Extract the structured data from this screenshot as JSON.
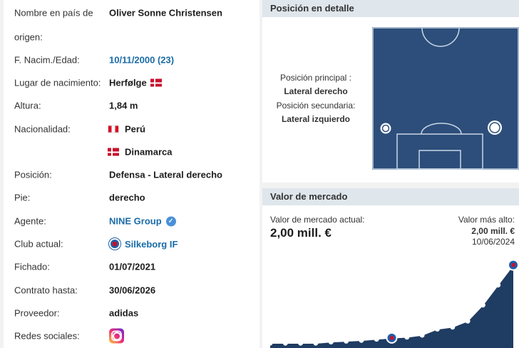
{
  "info_rows": [
    {
      "label": "Nombre en país de",
      "value": "Oliver Sonne Christensen"
    },
    {
      "label": "origen:",
      "value": ""
    },
    {
      "label": "F. Nacim./Edad:",
      "value": "10/11/2000 (23)"
    },
    {
      "label": "Lugar de nacimiento:",
      "value": "Herfølge"
    },
    {
      "label": "Altura:",
      "value": "1,84 m"
    },
    {
      "label": "Nacionalidad:",
      "value": "Perú"
    },
    {
      "label": "",
      "value": "Dinamarca"
    },
    {
      "label": "Posición:",
      "value": "Defensa - Lateral derecho"
    },
    {
      "label": "Pie:",
      "value": "derecho"
    },
    {
      "label": "Agente:",
      "value": "NINE Group"
    },
    {
      "label": "Club actual:",
      "value": "Silkeborg IF"
    },
    {
      "label": "Fichado:",
      "value": "01/07/2021"
    },
    {
      "label": "Contrato hasta:",
      "value": "30/06/2026"
    },
    {
      "label": "Proveedor:",
      "value": "adidas"
    },
    {
      "label": "Redes sociales:",
      "value": ""
    }
  ],
  "position_panel": {
    "title": "Posición en detalle",
    "main_label": "Posición principal :",
    "main_value": "Lateral derecho",
    "secondary_label": "Posición secundaria:",
    "secondary_value": "Lateral izquierdo"
  },
  "market_panel": {
    "title": "Valor de mercado",
    "current_label": "Valor de mercado actual:",
    "current_value": "2,00 mill. €",
    "highest_label": "Valor más alto:",
    "highest_value": "2,00 mill. €",
    "highest_date": "10/06/2024"
  },
  "chart_data": {
    "type": "line",
    "values": [
      0.05,
      0.05,
      0.05,
      0.05,
      0.08,
      0.1,
      0.12,
      0.15,
      0.18,
      0.2,
      0.25,
      0.4,
      0.45,
      0.6,
      1.0,
      1.5,
      2.0
    ],
    "ylim": [
      0,
      2.1
    ]
  },
  "colors": {
    "link": "#1a6ca8",
    "field": "#2d4e7a",
    "chart_fill": "#1f3c63",
    "header_bg": "#dfe6ec"
  }
}
